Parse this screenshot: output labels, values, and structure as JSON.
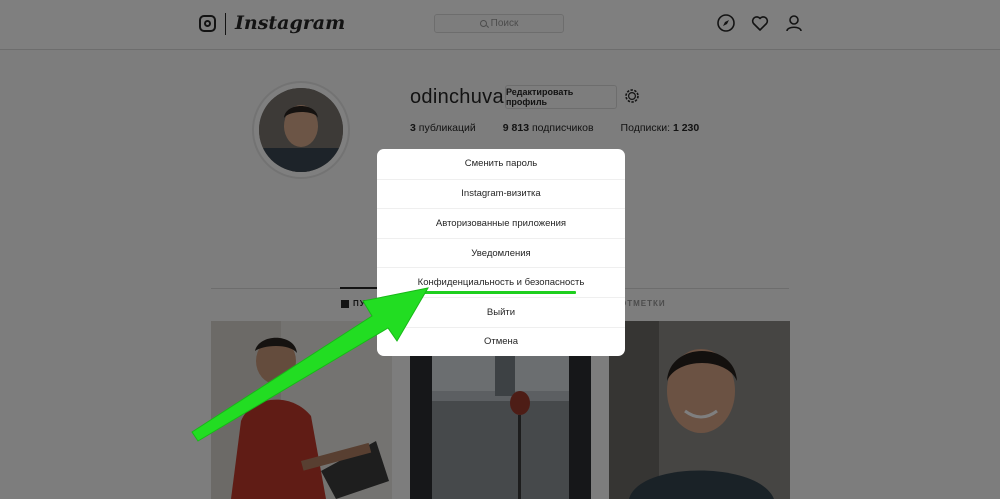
{
  "header": {
    "logo_text": "Instagram",
    "search_placeholder": "Поиск",
    "icons": [
      "compass-icon",
      "heart-icon",
      "user-icon"
    ]
  },
  "profile": {
    "username": "odinchuvak",
    "edit_button": "Редактировать профиль",
    "stats": {
      "posts_count": "3",
      "posts_label": "публикаций",
      "followers_count": "9 813",
      "followers_label": "подписчиков",
      "following_label": "Подписки:",
      "following_count": "1 230"
    }
  },
  "tabs": {
    "posts": "ПУБЛИ",
    "tagged": "ОТМЕТКИ"
  },
  "modal": {
    "items": [
      "Сменить пароль",
      "Instagram-визитка",
      "Авторизованные приложения",
      "Уведомления",
      "Конфиденциальность и безопасность",
      "Выйти",
      "Отмена"
    ],
    "highlighted_index": 4
  },
  "colors": {
    "overlay": "rgba(0,0,0,0.5)",
    "highlight": "#1fcf1f",
    "arrow": "#22dd22"
  }
}
